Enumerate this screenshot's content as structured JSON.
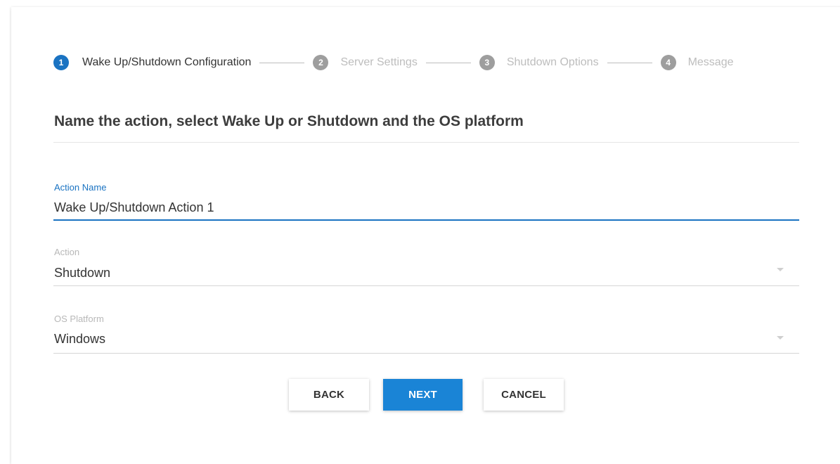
{
  "stepper": {
    "steps": [
      {
        "number": "1",
        "label": "Wake Up/Shutdown Configuration",
        "active": true
      },
      {
        "number": "2",
        "label": "Server Settings",
        "active": false
      },
      {
        "number": "3",
        "label": "Shutdown Options",
        "active": false
      },
      {
        "number": "4",
        "label": "Message",
        "active": false
      }
    ]
  },
  "form": {
    "title": "Name the action, select Wake Up or Shutdown and the OS platform",
    "action_name": {
      "label": "Action Name",
      "value": "Wake Up/Shutdown Action 1"
    },
    "action": {
      "label": "Action",
      "value": "Shutdown"
    },
    "os_platform": {
      "label": "OS Platform",
      "value": "Windows"
    }
  },
  "buttons": {
    "back": "BACK",
    "next": "NEXT",
    "cancel": "CANCEL"
  },
  "colors": {
    "accent": "#1a73c2",
    "primary_button": "#1a84d6",
    "inactive": "#9e9e9e"
  },
  "icons": {
    "select_caret": "caret-down-icon"
  }
}
